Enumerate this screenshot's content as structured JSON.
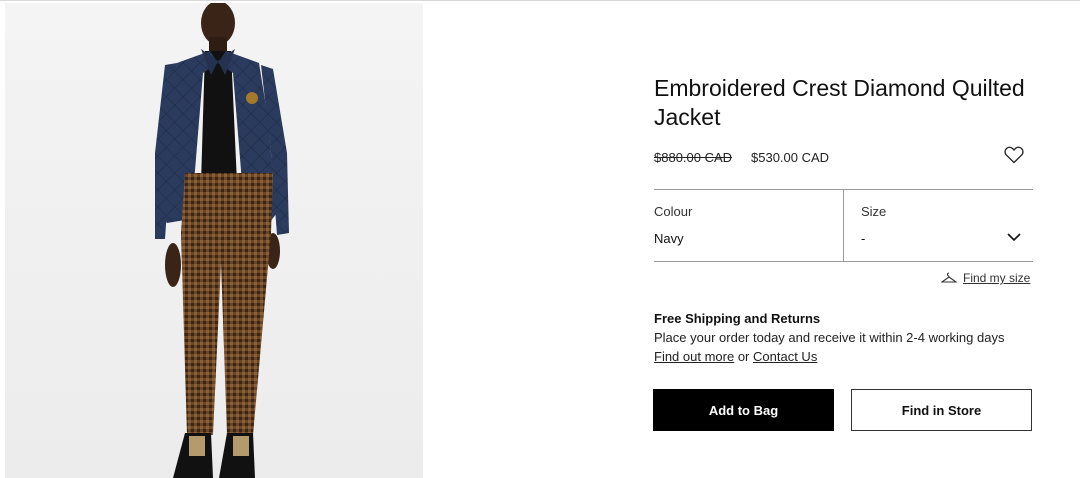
{
  "product": {
    "title": "Embroidered Crest Diamond Quilted Jacket",
    "price_original": "$880.00 CAD",
    "price_sale": "$530.00 CAD"
  },
  "icons": {
    "wishlist": "heart-outline-icon",
    "size_chevron": "chevron-down-icon",
    "find_size": "hanger-icon"
  },
  "colour": {
    "label": "Colour",
    "value": "Navy"
  },
  "size": {
    "label": "Size",
    "value": "-"
  },
  "find_size": {
    "label": "Find my size"
  },
  "shipping": {
    "title": "Free Shipping and Returns",
    "text": "Place your order today and receive it within 2-4 working days",
    "link1": "Find out more",
    "connector": "or",
    "link2": "Contact Us"
  },
  "actions": {
    "add_to_bag": "Add to Bag",
    "find_in_store": "Find in Store"
  },
  "colors": {
    "primary": "#000000",
    "jacket": "#2a3a5c",
    "trousers": "#6b4a2c"
  }
}
